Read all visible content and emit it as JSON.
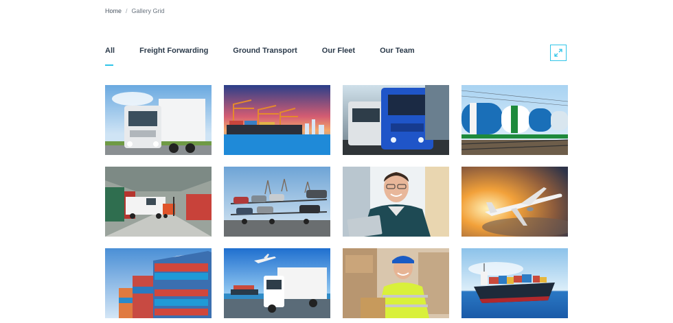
{
  "breadcrumb": {
    "home": "Home",
    "separator": "/",
    "current": "Gallery Grid"
  },
  "tabs": [
    {
      "label": "All",
      "active": true
    },
    {
      "label": "Freight Forwarding",
      "active": false
    },
    {
      "label": "Ground Transport",
      "active": false
    },
    {
      "label": "Our Fleet",
      "active": false
    },
    {
      "label": "Our Team",
      "active": false
    }
  ],
  "expand_button": {
    "icon": "expand-icon"
  },
  "colors": {
    "accent": "#2fc4e8",
    "text": "#2b3a4a"
  },
  "gallery": [
    {
      "name": "white-truck-photo"
    },
    {
      "name": "cargo-port-cranes-photo"
    },
    {
      "name": "blue-truck-photo"
    },
    {
      "name": "tank-train-photo"
    },
    {
      "name": "warehouse-forklift-photo"
    },
    {
      "name": "car-carrier-truck-photo"
    },
    {
      "name": "delivery-man-photo"
    },
    {
      "name": "airplane-sunset-photo"
    },
    {
      "name": "shipping-containers-photo"
    },
    {
      "name": "truck-plane-ship-photo"
    },
    {
      "name": "warehouse-worker-photo"
    },
    {
      "name": "container-ship-photo"
    }
  ]
}
